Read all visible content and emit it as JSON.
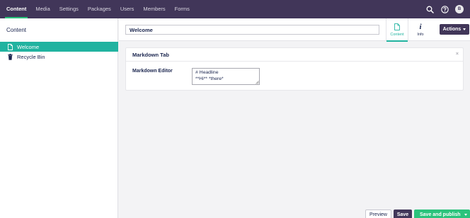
{
  "nav": {
    "items": [
      "Content",
      "Media",
      "Settings",
      "Packages",
      "Users",
      "Members",
      "Forms"
    ],
    "active_index": 0,
    "avatar_initial": "B"
  },
  "tree": {
    "title": "Content",
    "items": [
      {
        "label": "Welcome",
        "icon": "document-icon",
        "selected": true
      },
      {
        "label": "Recycle Bin",
        "icon": "trash-icon",
        "selected": false
      }
    ]
  },
  "header": {
    "name_value": "Welcome",
    "tabs": [
      {
        "label": "Content",
        "icon": "document-icon",
        "active": true
      },
      {
        "label": "Info",
        "icon": "info-icon",
        "active": false
      }
    ],
    "actions_label": "Actions"
  },
  "panel": {
    "title": "Markdown Tab",
    "close_glyph": "×",
    "property_label": "Markdown Editor",
    "editor_value": "# Headline\n**Hi** *there*"
  },
  "footer": {
    "preview_label": "Preview",
    "save_label": "Save",
    "publish_label": "Save and publish"
  },
  "colors": {
    "topbar": "#413659",
    "accent_teal": "#21b3a0",
    "green": "#2bc37c",
    "text": "#1b264f"
  }
}
